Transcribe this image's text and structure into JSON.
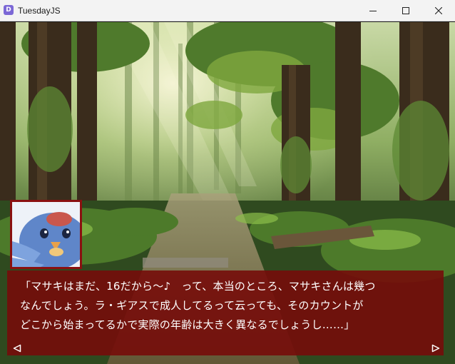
{
  "window": {
    "title": "TuesdayJS",
    "app_icon_letter": "D"
  },
  "scene": {
    "background": "forest-clearing-illustration"
  },
  "dialog": {
    "lines": [
      "「マサキはまだ、16だから〜♪　って、本当のところ、マサキさんは幾つ",
      "なんでしょう。ラ・ギアスで成人してるって云っても、そのカウントが",
      "どこから始まってるかで実際の年齢は大きく異なるでしょうし……」"
    ],
    "box_color": "#760c0a",
    "text_color": "#ffffff"
  },
  "nav": {
    "prev_icon": "triangle-left-icon",
    "next_icon": "triangle-right-icon"
  }
}
